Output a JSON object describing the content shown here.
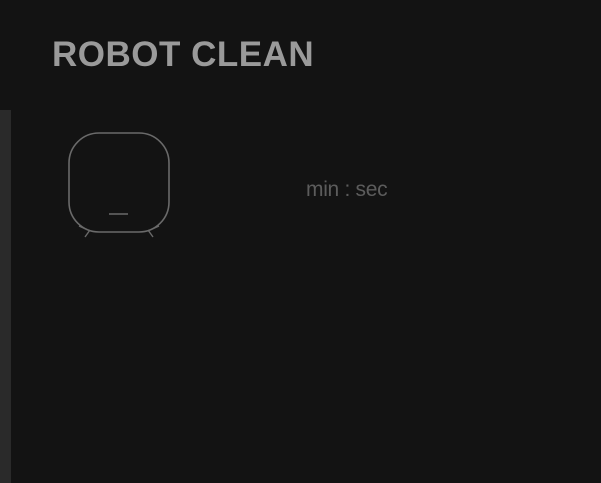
{
  "header": {
    "title": "ROBOT CLEAN"
  },
  "device": {
    "icon": "robot-vacuum-icon"
  },
  "timer": {
    "units_label": "min : sec"
  },
  "colors": {
    "background": "#131313",
    "rail": "#2a2a2a",
    "title": "#9a9a9a",
    "icon_stroke": "#6a6a6a",
    "muted_text": "#5c5c5c"
  }
}
